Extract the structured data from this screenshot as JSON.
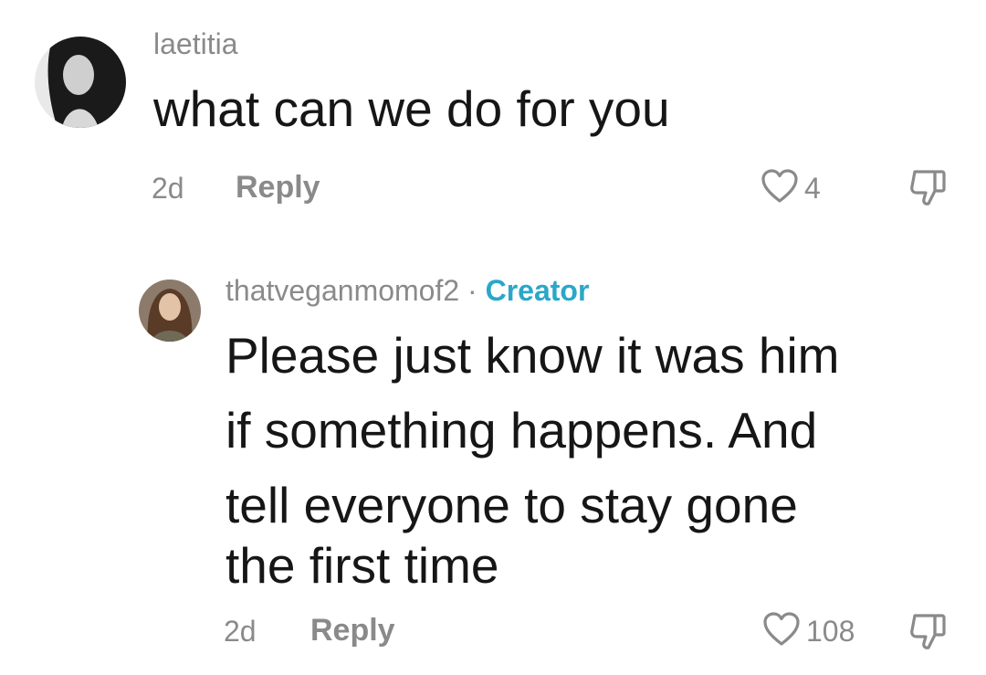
{
  "comments": [
    {
      "username": "laetitia",
      "text": "what can we do for you",
      "age": "2d",
      "reply_label": "Reply",
      "like_count": "4",
      "icons": {
        "like": "heart-outline-icon",
        "dislike": "thumbs-down-icon"
      }
    },
    {
      "username": "thatveganmomof2",
      "separator": "·",
      "badge": "Creator",
      "badge_color": "#2aa7c9",
      "text_lines": [
        "Please just know it was him",
        "if something happens. And",
        "tell everyone to stay gone",
        "the first time"
      ],
      "age": "2d",
      "reply_label": "Reply",
      "like_count": "108",
      "icons": {
        "like": "heart-outline-icon",
        "dislike": "thumbs-down-icon"
      }
    }
  ]
}
